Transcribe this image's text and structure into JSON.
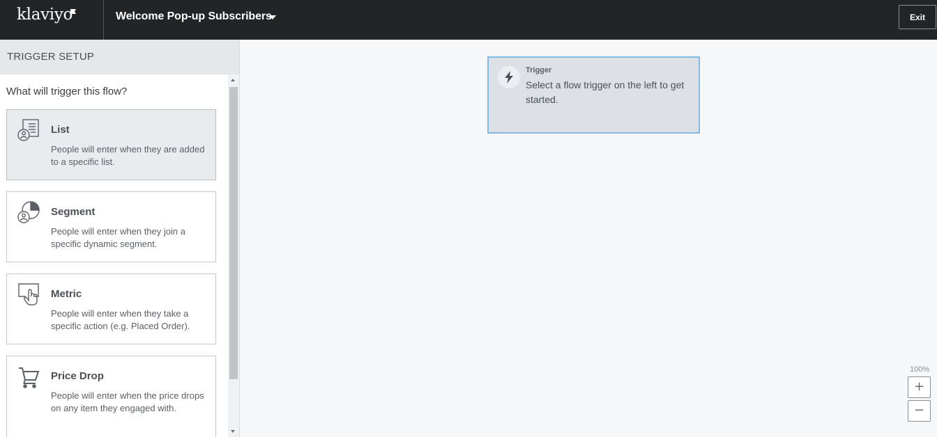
{
  "header": {
    "logo_text": "klaviyo",
    "flow_title": "Welcome Pop-up Subscribers",
    "exit_label": "Exit"
  },
  "sidebar": {
    "section_title": "TRIGGER SETUP",
    "question": "What will trigger this flow?",
    "triggers": [
      {
        "icon": "list-icon",
        "title": "List",
        "description": "People will enter when they are added to a specific list.",
        "selected": true
      },
      {
        "icon": "segment-icon",
        "title": "Segment",
        "description": "People will enter when they join a specific dynamic segment.",
        "selected": false
      },
      {
        "icon": "metric-icon",
        "title": "Metric",
        "description": "People will enter when they take a specific action (e.g. Placed Order).",
        "selected": false
      },
      {
        "icon": "cart-icon",
        "title": "Price Drop",
        "description": "People will enter when the price drops on any item they engaged with.",
        "selected": false
      }
    ]
  },
  "canvas": {
    "trigger_node": {
      "label": "Trigger",
      "text": "Select a flow trigger on the left to get started."
    },
    "zoom": {
      "level": "100%",
      "zoom_in": "+",
      "zoom_out": "−"
    }
  },
  "colors": {
    "topbar": "#232426",
    "canvas_bg": "#f6f7f8",
    "trigger_node_bg": "#dde1e6",
    "trigger_node_border": "#7fbbe6",
    "selected_card_bg": "#e9ecee"
  }
}
